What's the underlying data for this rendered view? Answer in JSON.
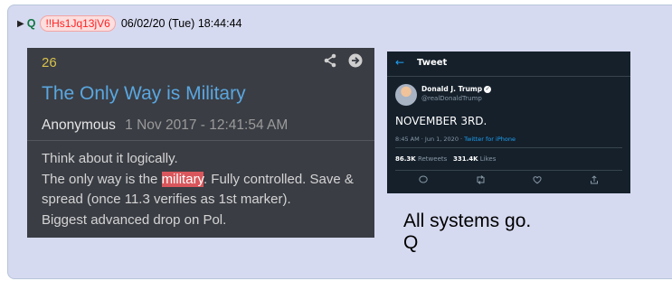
{
  "post": {
    "q_marker": "Q",
    "tripcode": "!!Hs1Jq13jV6",
    "datetime": "06/02/20 (Tue) 18:44:44"
  },
  "embedded_post": {
    "number": "26",
    "title": "The Only Way is Military",
    "author": "Anonymous",
    "timestamp": "1 Nov 2017 - 12:41:54 AM",
    "body": {
      "line1": "Think about it logically.",
      "line2_before": "The only way is the ",
      "line2_highlight": "military",
      "line2_after": ". Fully controlled. Save &",
      "line3": "spread (once 11.3 verifies as 1st marker).",
      "line4": "Biggest advanced drop on Pol."
    },
    "icons": [
      "share-icon",
      "forward-arrow-icon"
    ]
  },
  "tweet": {
    "header_label": "Tweet",
    "display_name": "Donald J. Trump",
    "handle": "@realDonaldTrump",
    "text": "NOVEMBER 3RD.",
    "time": "8:45 AM · Jun 1, 2020 · ",
    "source": "Twitter for iPhone",
    "retweets": "86.3K",
    "retweets_label": "Retweets",
    "likes": "331.4K",
    "likes_label": "Likes",
    "accent": "#1da1f2",
    "icons": [
      "back-arrow-icon",
      "reply-icon",
      "retweet-icon",
      "like-icon",
      "share-icon"
    ]
  },
  "caption": {
    "line1": "All systems go.",
    "line2": "Q"
  }
}
